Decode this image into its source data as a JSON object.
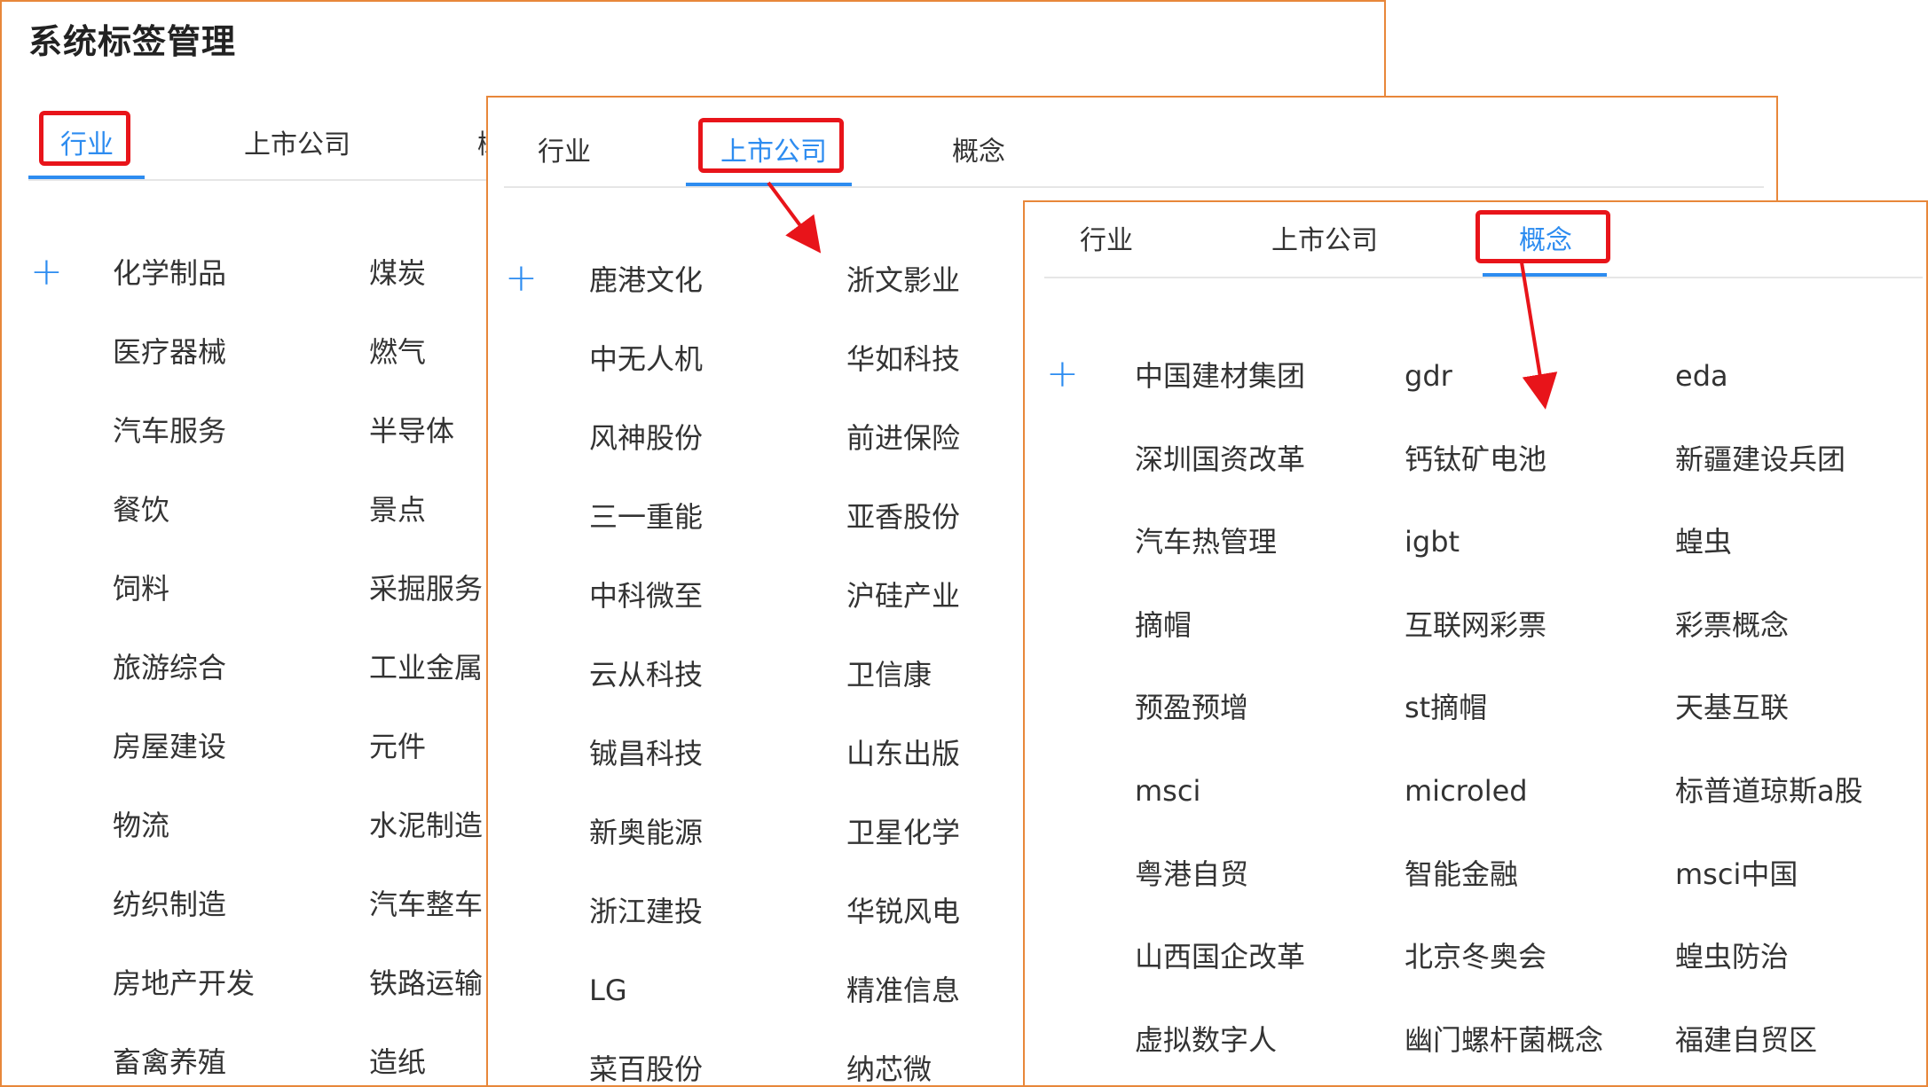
{
  "panel1": {
    "title": "系统标签管理",
    "tabs": [
      "行业",
      "上市公司",
      "概"
    ],
    "col1": [
      "化学制品",
      "医疗器械",
      "汽车服务",
      "餐饮",
      "饲料",
      "旅游综合",
      "房屋建设",
      "物流",
      "纺织制造",
      "房地产开发",
      "畜禽养殖"
    ],
    "col2": [
      "煤炭",
      "燃气",
      "半导体",
      "景点",
      "采掘服务",
      "工业金属",
      "元件",
      "水泥制造",
      "汽车整车",
      "铁路运输",
      "造纸"
    ]
  },
  "panel2": {
    "tabs": [
      "行业",
      "上市公司",
      "概念"
    ],
    "col1": [
      "鹿港文化",
      "中无人机",
      "风神股份",
      "三一重能",
      "中科微至",
      "云从科技",
      "铖昌科技",
      "新奥能源",
      "浙江建投",
      "LG",
      "菜百股份"
    ],
    "col2": [
      "浙文影业",
      "华如科技",
      "前进保险",
      "亚香股份",
      "沪硅产业",
      "卫信康",
      "山东出版",
      "卫星化学",
      "华锐风电",
      "精准信息",
      "纳芯微"
    ]
  },
  "panel3": {
    "tabs": [
      "行业",
      "上市公司",
      "概念"
    ],
    "col1": [
      "中国建材集团",
      "深圳国资改革",
      "汽车热管理",
      "摘帽",
      "预盈预增",
      "msci",
      "粤港自贸",
      "山西国企改革",
      "虚拟数字人"
    ],
    "col2": [
      "gdr",
      "钙钛矿电池",
      "igbt",
      "互联网彩票",
      "st摘帽",
      "microled",
      "智能金融",
      "北京冬奥会",
      "幽门螺杆菌概念"
    ],
    "col3": [
      "eda",
      "新疆建设兵团",
      "蝗虫",
      "彩票概念",
      "天基互联",
      "标普道琼斯a股",
      "msci中国",
      "蝗虫防治",
      "福建自贸区"
    ]
  },
  "add_symbol": "+",
  "colors": {
    "accent": "#2d8cf0",
    "highlight": "#e8141a",
    "panel_border": "#e8873a"
  },
  "icons": [
    "plus-icon",
    "arrow-annotation"
  ]
}
